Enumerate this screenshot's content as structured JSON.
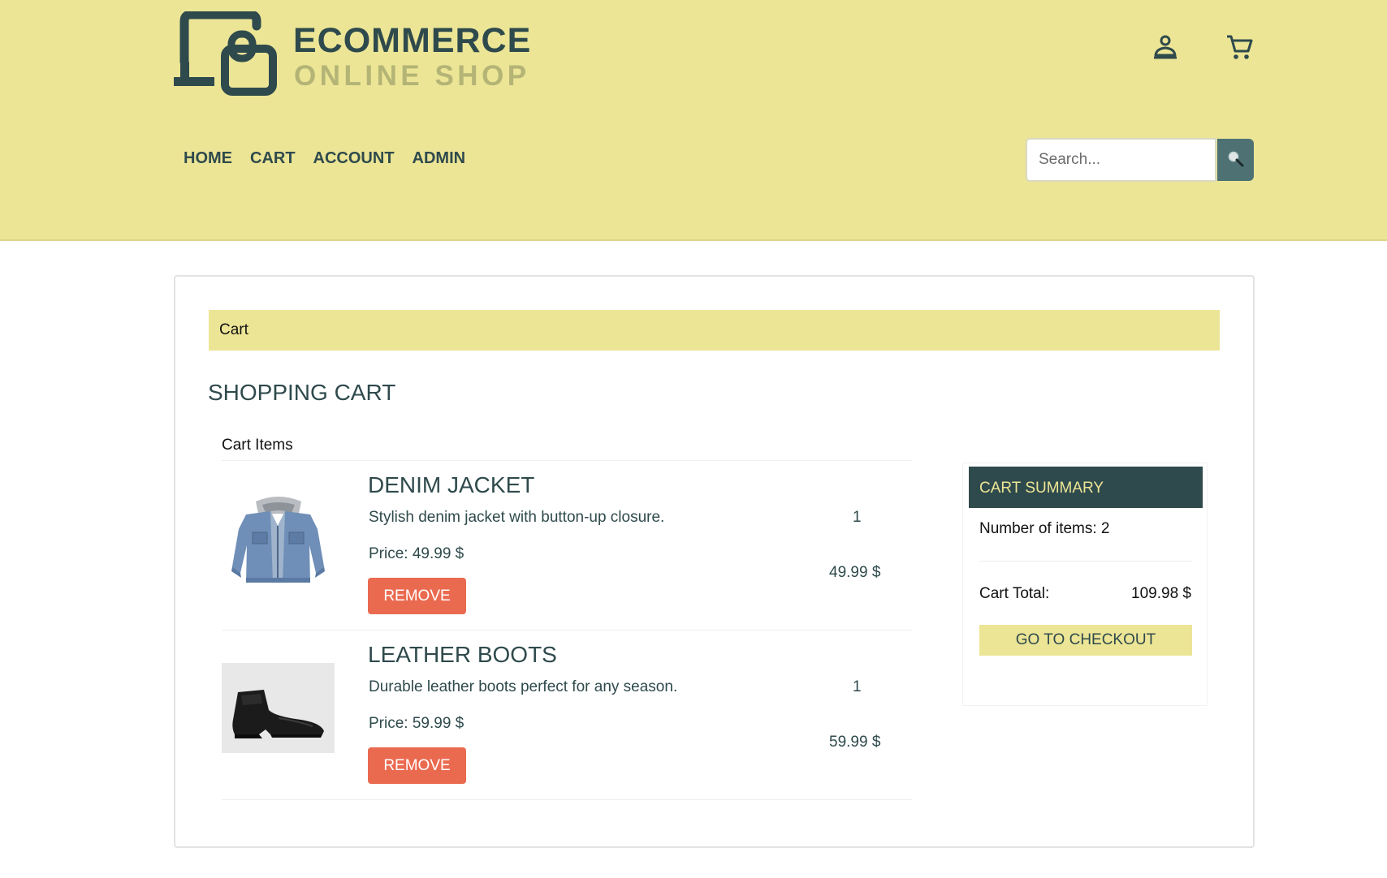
{
  "brand": {
    "title": "ECOMMERCE",
    "subtitle": "ONLINE SHOP",
    "logo_icon": "laptop-lock-icon"
  },
  "header_icons": [
    "user-icon",
    "cart-icon"
  ],
  "nav": {
    "items": [
      {
        "label": "HOME"
      },
      {
        "label": "CART"
      },
      {
        "label": "ACCOUNT"
      },
      {
        "label": "ADMIN"
      }
    ]
  },
  "search": {
    "placeholder": "Search...",
    "value": "",
    "button_icon": "search-icon"
  },
  "breadcrumb": {
    "current": "Cart"
  },
  "page_title": "SHOPPING CART",
  "cart": {
    "items_label": "Cart Items",
    "items": [
      {
        "name": "DENIM JACKET",
        "description": "Stylish denim jacket with button-up closure.",
        "price": "Price: 49.99 $",
        "quantity": "1",
        "subtotal": "49.99 $",
        "remove_label": "REMOVE"
      },
      {
        "name": "LEATHER BOOTS",
        "description": "Durable leather boots perfect for any season.",
        "price": "Price: 59.99 $",
        "quantity": "1",
        "subtotal": "59.99 $",
        "remove_label": "REMOVE"
      }
    ]
  },
  "summary": {
    "title": "CART SUMMARY",
    "count": "Number of items: 2",
    "total_label": "Cart Total:",
    "total_value": "109.98 $",
    "checkout_label": "GO TO CHECKOUT"
  },
  "colors": {
    "header_bg": "#ece596",
    "primary_dark": "#2f4a4c",
    "accent_muted": "#b3b475",
    "remove_button": "#ea6a50",
    "search_button": "#4e7274"
  }
}
